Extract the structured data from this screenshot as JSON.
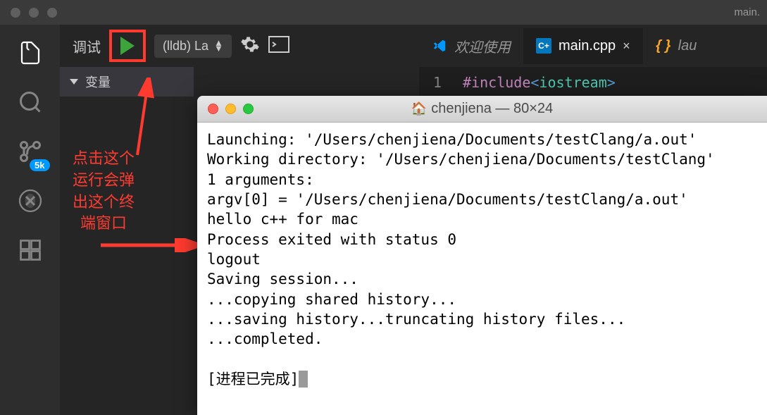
{
  "titlebar": {
    "title": "main."
  },
  "debug": {
    "label": "调试",
    "config_name": "(lldb) La",
    "variables_header": "变量"
  },
  "activity": {
    "badge": "5k"
  },
  "tabs": {
    "welcome": "欢迎使用",
    "main": "main.cpp",
    "launch": "lau"
  },
  "code": {
    "line": "1",
    "include_keyword": "#include",
    "include_header": "iostream"
  },
  "annotation": {
    "line1": "点击这个",
    "line2": "运行会弹",
    "line3": "出这个终",
    "line4": "端窗口"
  },
  "terminal": {
    "title": "chenjiena — 80×24",
    "lines": [
      "Launching: '/Users/chenjiena/Documents/testClang/a.out'",
      "Working directory: '/Users/chenjiena/Documents/testClang'",
      "1 arguments:",
      "argv[0] = '/Users/chenjiena/Documents/testClang/a.out'",
      "hello c++ for mac",
      "Process exited with status 0",
      "logout",
      "Saving session...",
      "...copying shared history...",
      "...saving history...truncating history files...",
      "...completed.",
      "",
      "[进程已完成]"
    ]
  }
}
